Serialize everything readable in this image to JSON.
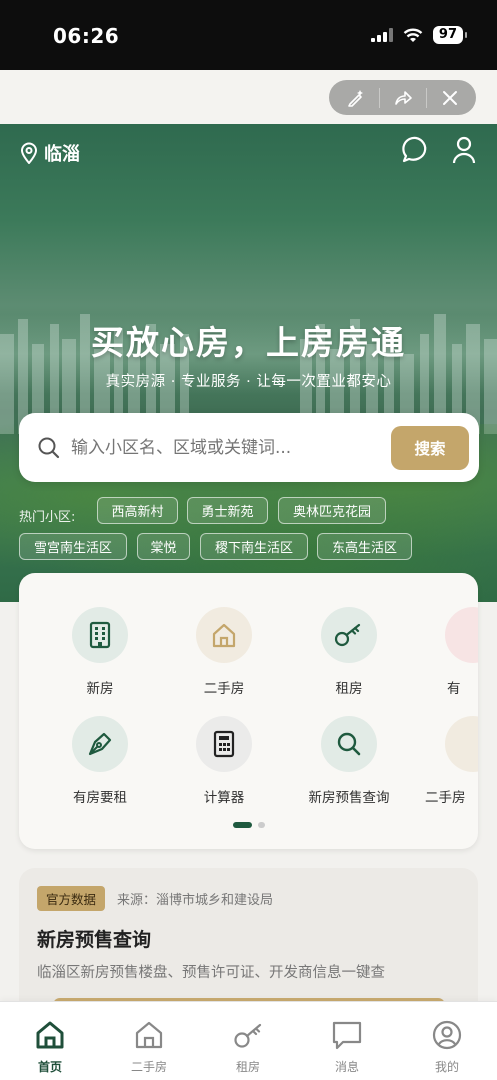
{
  "status_bar": {
    "time": "06:26",
    "battery": "97"
  },
  "header": {
    "location": "临淄"
  },
  "hero": {
    "title": "买放心房，上房房通",
    "subtitle": "真实房源 · 专业服务 · 让每一次置业都安心"
  },
  "search": {
    "placeholder": "输入小区名、区域或关键词...",
    "button": "搜索"
  },
  "hot": {
    "label": "热门小区:",
    "tags": [
      "西高新村",
      "勇士新苑",
      "奥林匹克花园",
      "雪宫南生活区",
      "棠悦",
      "稷下南生活区",
      "东高生活区"
    ]
  },
  "grid": {
    "items": [
      "新房",
      "二手房",
      "租房",
      "有",
      "有房要租",
      "计算器",
      "新房预售查询",
      "二手房"
    ]
  },
  "info": {
    "badge": "官方数据",
    "source": "来源：淄博市城乡和建设局",
    "title": "新房预售查询",
    "desc": "临淄区新房预售楼盘、预售许可证、开发商信息一键查"
  },
  "tabbar": {
    "items": [
      "首页",
      "二手房",
      "租房",
      "消息",
      "我的"
    ],
    "active": "首页"
  },
  "colors": {
    "brand_green": "#1f5a3f",
    "accent_gold": "#c4a66b"
  }
}
